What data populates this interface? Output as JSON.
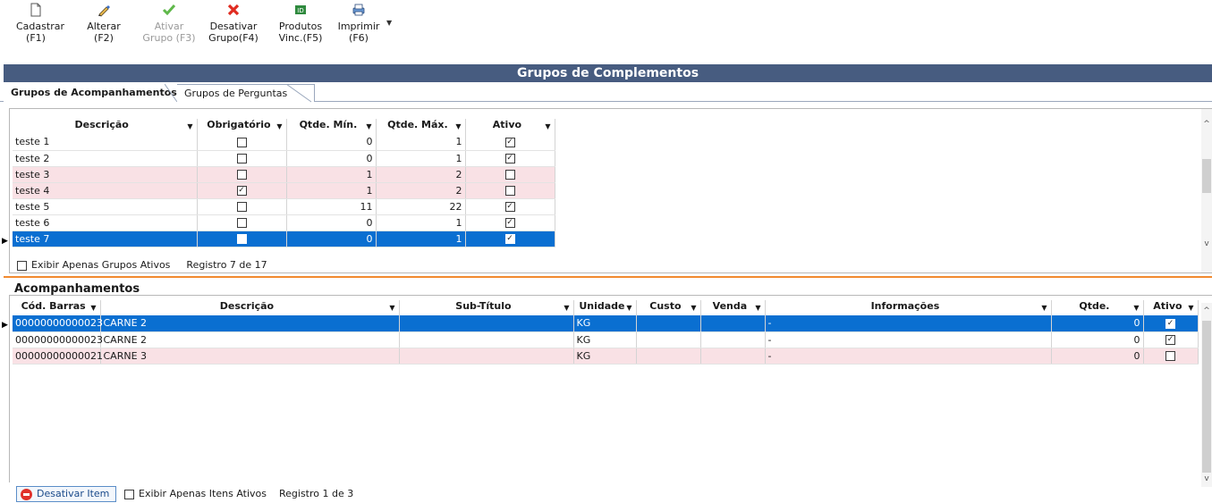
{
  "toolbar": {
    "cadastrar": {
      "line1": "Cadastrar",
      "line2": "(F1)"
    },
    "alterar": {
      "line1": "Alterar",
      "line2": "(F2)"
    },
    "ativar": {
      "line1": "Ativar",
      "line2": "Grupo (F3)"
    },
    "desativar": {
      "line1": "Desativar",
      "line2": "Grupo(F4)"
    },
    "produtos": {
      "line1": "Produtos",
      "line2": "Vinc.(F5)"
    },
    "imprimir": {
      "line1": "Imprimir",
      "line2": "(F6)"
    }
  },
  "title": "Grupos de Complementos",
  "tabs": [
    "Grupos de Acompanhamentos",
    "Grupos de Perguntas"
  ],
  "grupos": {
    "columns": [
      "Descrição",
      "Obrigatório",
      "Qtde. Mín.",
      "Qtde. Máx.",
      "Ativo"
    ],
    "rows": [
      {
        "descricao": "teste 1",
        "obrigatorio": false,
        "min": "0",
        "max": "1",
        "ativo": true,
        "style": "normal"
      },
      {
        "descricao": "teste 2",
        "obrigatorio": false,
        "min": "0",
        "max": "1",
        "ativo": true,
        "style": "normal"
      },
      {
        "descricao": "teste 3",
        "obrigatorio": false,
        "min": "1",
        "max": "2",
        "ativo": false,
        "style": "pink"
      },
      {
        "descricao": "teste 4",
        "obrigatorio": true,
        "min": "1",
        "max": "2",
        "ativo": false,
        "style": "pink"
      },
      {
        "descricao": "teste 5",
        "obrigatorio": false,
        "min": "11",
        "max": "22",
        "ativo": true,
        "style": "normal"
      },
      {
        "descricao": "teste 6",
        "obrigatorio": false,
        "min": "0",
        "max": "1",
        "ativo": true,
        "style": "normal"
      },
      {
        "descricao": "teste 7",
        "obrigatorio": false,
        "min": "0",
        "max": "1",
        "ativo": true,
        "style": "sel"
      }
    ],
    "filter_label": "Exibir Apenas Grupos Ativos",
    "record_text": "Registro 7 de 17"
  },
  "acompanhamentos": {
    "title": "Acompanhamentos",
    "columns": [
      "Cód. Barras",
      "Descrição",
      "Sub-Título",
      "Unidade",
      "Custo",
      "Venda",
      "Informações",
      "Qtde.",
      "Ativo"
    ],
    "rows": [
      {
        "cod": "00000000000023",
        "descricao": "CARNE 2",
        "subtitulo": "",
        "unidade": "KG",
        "custo": "",
        "venda": "",
        "info": "-",
        "qtde": "0",
        "ativo": true,
        "style": "sel"
      },
      {
        "cod": "00000000000023",
        "descricao": "CARNE 2",
        "subtitulo": "",
        "unidade": "KG",
        "custo": "",
        "venda": "",
        "info": "-",
        "qtde": "0",
        "ativo": true,
        "style": "normal"
      },
      {
        "cod": "00000000000021",
        "descricao": "CARNE 3",
        "subtitulo": "",
        "unidade": "KG",
        "custo": "",
        "venda": "",
        "info": "-",
        "qtde": "0",
        "ativo": false,
        "style": "pink"
      }
    ],
    "deactivate_label": "Desativar Item",
    "filter_label": "Exibir Apenas Itens Ativos",
    "record_text": "Registro 1 de 3"
  },
  "colors": {
    "title_bar": "#475c80",
    "selected_row": "#0a6fd1",
    "inactive_row": "#f9e1e5",
    "divider": "#f28a30"
  },
  "icons": [
    "new-document-icon",
    "pencil-icon",
    "check-icon",
    "x-icon",
    "products-icon",
    "printer-icon"
  ]
}
